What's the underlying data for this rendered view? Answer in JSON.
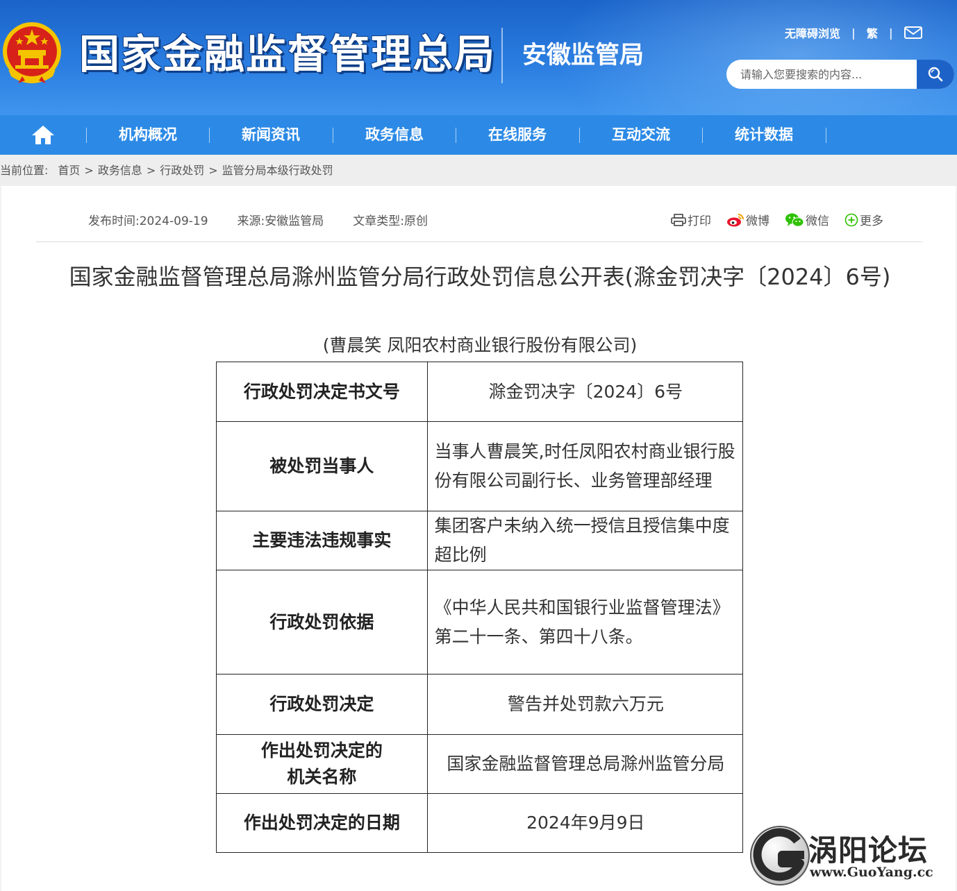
{
  "header": {
    "site_title": "国家金融监督管理总局",
    "sub_title": "安徽监管局",
    "accessible_link": "无障碍浏览",
    "traditional_link": "繁",
    "search_placeholder": "请输入您要搜索的内容..."
  },
  "nav": {
    "items": [
      "机构概况",
      "新闻资讯",
      "政务信息",
      "在线服务",
      "互动交流",
      "统计数据"
    ]
  },
  "breadcrumb": {
    "label": "当前位置:",
    "items": [
      "首页",
      "政务信息",
      "行政处罚",
      "监管分局本级行政处罚"
    ]
  },
  "meta": {
    "publish_time": "发布时间:2024-09-19",
    "source": "来源:安徽监管局",
    "article_type": "文章类型:原创"
  },
  "share": {
    "print": "打印",
    "weibo": "微博",
    "wechat": "微信",
    "more": "更多"
  },
  "article": {
    "title": "国家金融监督管理总局滁州监管分局行政处罚信息公开表(滁金罚决字〔2024〕6号)",
    "caption": "(曹晨笑 凤阳农村商业银行股份有限公司)",
    "rows": [
      {
        "key": "行政处罚决定书文号",
        "value": "滁金罚决字〔2024〕6号"
      },
      {
        "key": "被处罚当事人",
        "value": "当事人曹晨笑,时任凤阳农村商业银行股份有限公司副行长、业务管理部经理"
      },
      {
        "key": "主要违法违规事实",
        "value": "集团客户未纳入统一授信且授信集中度超比例"
      },
      {
        "key": "行政处罚依据",
        "value": "《中华人民共和国银行业监督管理法》第二十一条、第四十八条。"
      },
      {
        "key": "行政处罚决定",
        "value": "警告并处罚款六万元"
      },
      {
        "key": "作出处罚决定的机关名称",
        "value": "国家金融监督管理总局滁州监管分局"
      },
      {
        "key": "作出处罚决定的日期",
        "value": "2024年9月9日"
      }
    ]
  },
  "watermark": {
    "name": "涡阳论坛",
    "url": "www.GuoYang.cc"
  },
  "colors": {
    "header_blue": "#2a7de0",
    "nav_blue": "#2c8ae6",
    "breadcrumb_bg": "#eeeeee",
    "emblem_red": "#d7221a",
    "emblem_gold": "#f5c400"
  }
}
